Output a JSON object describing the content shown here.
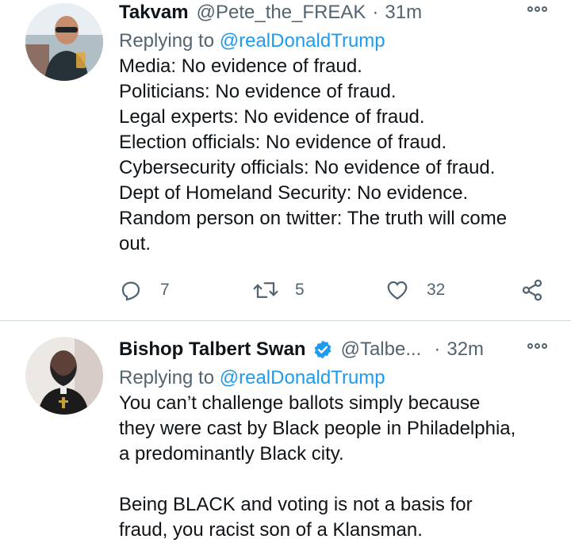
{
  "tweets": [
    {
      "display_name": "Takvam",
      "handle": "@Pete_the_FREAK",
      "separator": "·",
      "time": "31m",
      "replying_prefix": "Replying to ",
      "replying_to": "@realDonaldTrump",
      "lines": [
        "Media: No evidence of fraud.",
        "Politicians: No evidence of fraud.",
        "Legal experts: No evidence of fraud.",
        "Election officials: No evidence of fraud.",
        "Cybersecurity officials: No evidence of fraud.",
        "Dept of Homeland Security: No evidence.",
        "Random person on twitter: The truth will come",
        "out."
      ],
      "replies": "7",
      "retweets": "5",
      "likes": "32"
    },
    {
      "display_name": "Bishop Talbert Swan",
      "verified": true,
      "handle": "@Talbe...",
      "separator": "·",
      "time": "32m",
      "replying_prefix": "Replying to ",
      "replying_to": "@realDonaldTrump",
      "lines": [
        "You can’t challenge ballots simply because",
        "they were cast by Black people in Philadelphia,",
        "a predominantly Black city.",
        "",
        "Being BLACK and voting is not a basis for",
        "fraud, you racist son of a Klansman."
      ]
    }
  ],
  "colors": {
    "accent": "#1d9bf0",
    "secondary_text": "#536471",
    "primary_text": "#0f1419"
  }
}
